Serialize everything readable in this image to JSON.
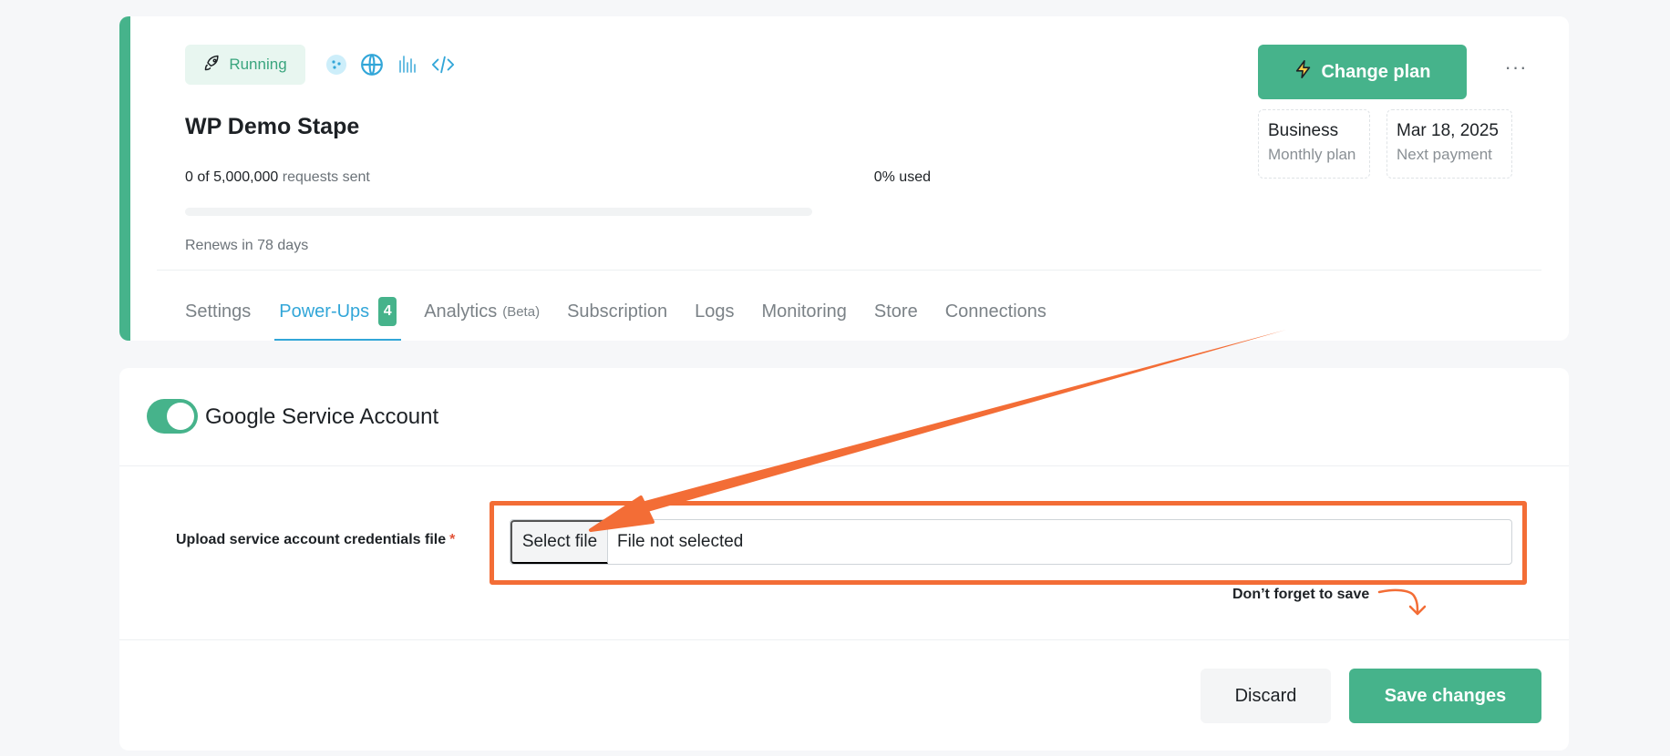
{
  "colors": {
    "brand_green": "#46b38b",
    "tab_active": "#32a6d8",
    "annotation_orange": "#f36d36",
    "required_red": "#e2553b"
  },
  "container": {
    "status": {
      "label": "Running",
      "icon": "rocket-icon"
    },
    "tag_icons": [
      "cookie-icon",
      "globe-icon",
      "signal-bars-icon",
      "code-icon"
    ],
    "title": "WP Demo Stape",
    "usage": {
      "count": "0 of 5,000,000",
      "suffix": "requests sent",
      "percent_label": "0% used",
      "percent_value": 0
    },
    "renews": "Renews in 78 days",
    "change_plan_label": "Change plan",
    "more_label": "···",
    "plan": {
      "name": "Business",
      "period": "Monthly plan"
    },
    "payment": {
      "date": "Mar 18, 2025",
      "label": "Next payment"
    }
  },
  "tabs": [
    {
      "label": "Settings"
    },
    {
      "label": "Power-Ups",
      "badge": "4",
      "active": true
    },
    {
      "label": "Analytics",
      "suffix": "(Beta)"
    },
    {
      "label": "Subscription"
    },
    {
      "label": "Logs"
    },
    {
      "label": "Monitoring"
    },
    {
      "label": "Store"
    },
    {
      "label": "Connections"
    }
  ],
  "powerup": {
    "enabled": true,
    "title": "Google Service Account",
    "field_label": "Upload service account credentials file",
    "required_mark": "*",
    "file_button": "Select file",
    "file_status": "File not selected",
    "save_note": "Don’t forget to save",
    "discard_label": "Discard",
    "save_label": "Save changes"
  }
}
